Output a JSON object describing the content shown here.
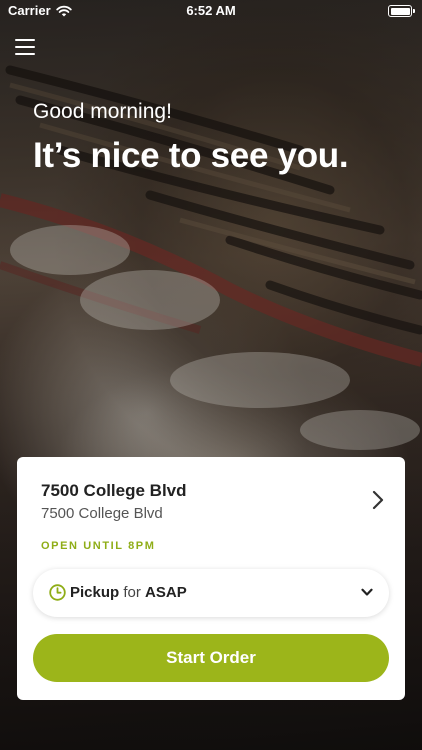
{
  "status_bar": {
    "carrier": "Carrier",
    "time": "6:52 AM"
  },
  "hero": {
    "greeting": "Good morning!",
    "headline": "It’s nice to see you."
  },
  "store_card": {
    "name": "7500 College Blvd",
    "address": "7500 College Blvd",
    "open_status": "OPEN UNTIL 8PM",
    "order_type": "Pickup",
    "for_label": "for",
    "time_selection": "ASAP",
    "start_order_label": "Start Order"
  },
  "colors": {
    "accent": "#9cb51a",
    "open_status": "#8fad17"
  },
  "icons": [
    "wifi-icon",
    "battery-icon",
    "menu-icon",
    "chevron-right-icon",
    "clock-icon",
    "chevron-down-icon"
  ]
}
